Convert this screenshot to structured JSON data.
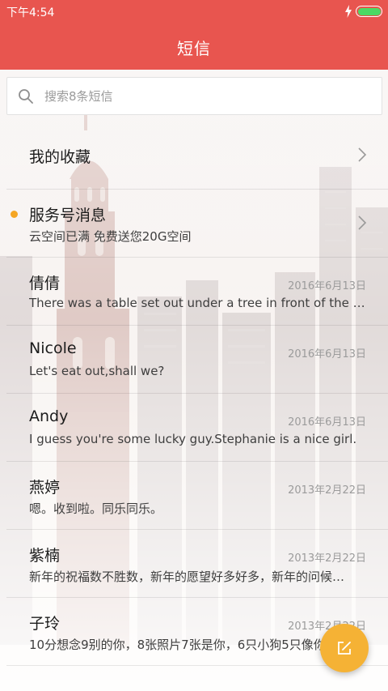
{
  "status_bar": {
    "time": "下午4:54"
  },
  "header": {
    "title": "短信"
  },
  "search": {
    "placeholder": "搜索8条短信"
  },
  "favorites": {
    "label": "我的收藏"
  },
  "service": {
    "title": "服务号消息",
    "preview": "云空间已满 免费送您20G空间"
  },
  "conversations": [
    {
      "name": "倩倩",
      "date": "2016年6月13日",
      "preview": "There was a table set out under a tree in front of the house..."
    },
    {
      "name": "Nicole",
      "date": "2016年6月13日",
      "preview": "Let's eat out,shall we?"
    },
    {
      "name": "Andy",
      "date": "2016年6月13日",
      "preview": "I guess you're some lucky guy.Stephanie is a nice girl."
    },
    {
      "name": "燕婷",
      "date": "2013年2月22日",
      "preview": "嗯。收到啦。同乐同乐。"
    },
    {
      "name": "紫楠",
      "date": "2013年2月22日",
      "preview": "新年的祝福数不胜数，新年的愿望好多好多，新年的问候…"
    },
    {
      "name": "子玲",
      "date": "2013年2月22日",
      "preview": "10分想念9别的你，8张照片7张是你，6只小狗5只像你…"
    }
  ],
  "colors": {
    "header": "#e8554f",
    "fab": "#f5b235",
    "unread_dot": "#f5a623",
    "battery": "#4cd964"
  },
  "icons": [
    "charging-icon",
    "battery-icon",
    "search-icon",
    "chevron-right-icon",
    "compose-icon"
  ]
}
